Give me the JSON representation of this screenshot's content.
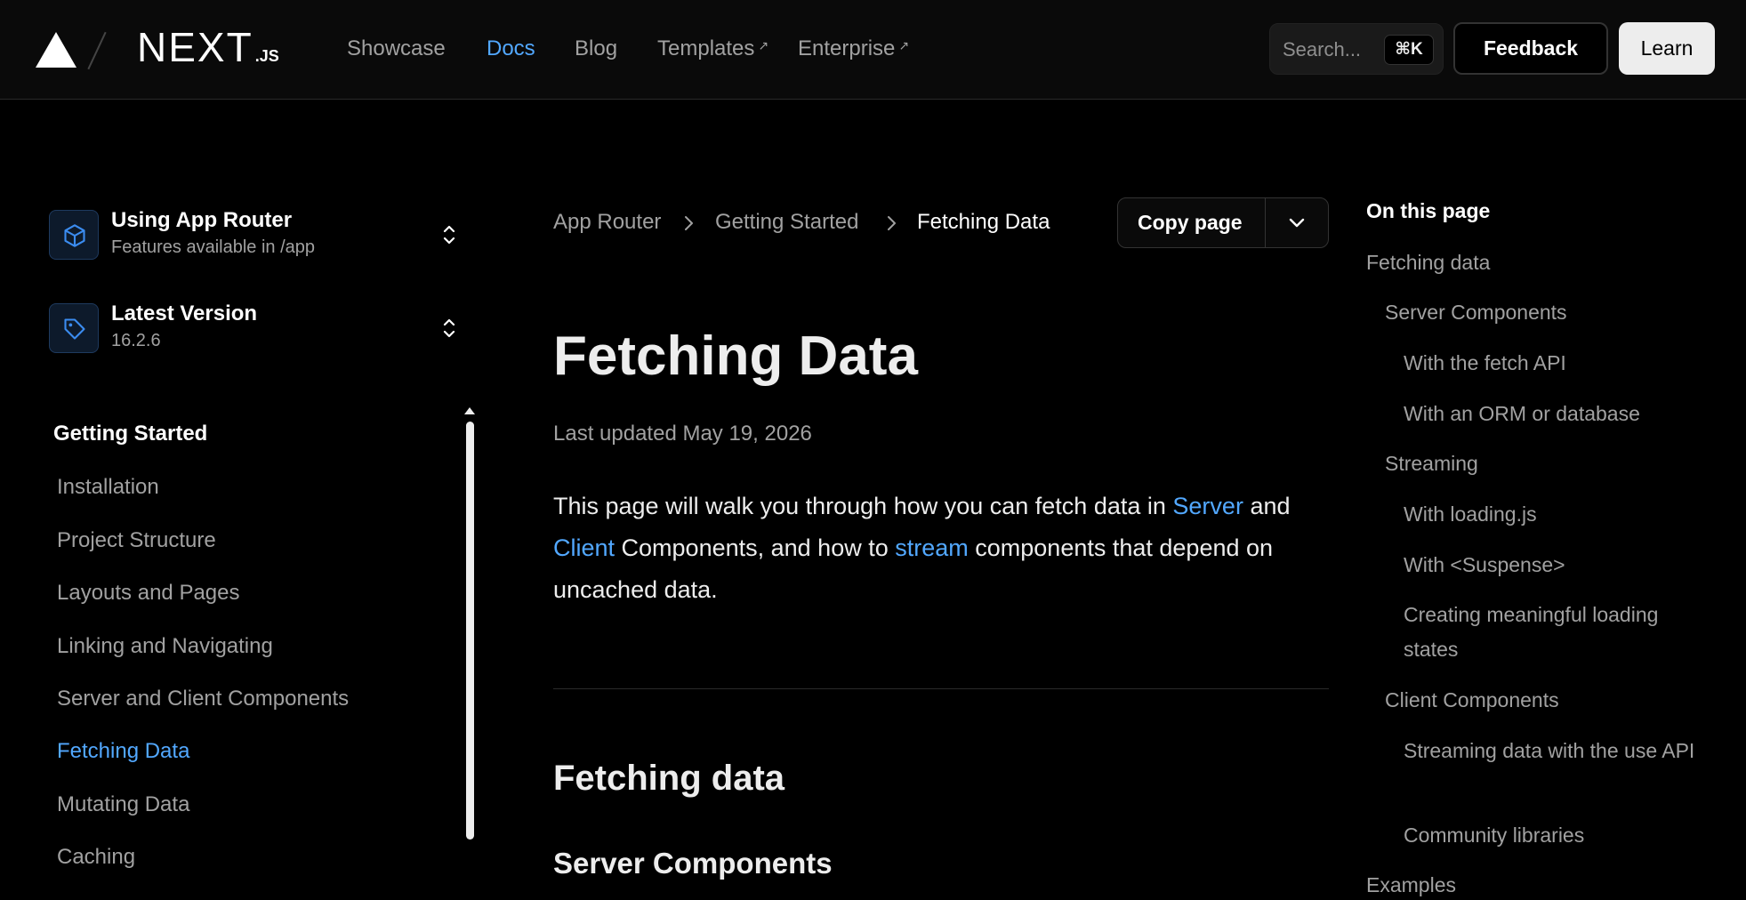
{
  "header": {
    "logo_text": "NEXT",
    "logo_suffix": ".JS",
    "nav": [
      {
        "label": "Showcase"
      },
      {
        "label": "Docs"
      },
      {
        "label": "Blog"
      },
      {
        "label": "Templates"
      },
      {
        "label": "Enterprise"
      }
    ],
    "external_marker": "↗",
    "search_placeholder": "Search...",
    "search_shortcut": "⌘K",
    "feedback_label": "Feedback",
    "learn_label": "Learn"
  },
  "sidebar": {
    "router_selector": {
      "title": "Using App Router",
      "subtitle": "Features available in /app"
    },
    "version_selector": {
      "title": "Latest Version",
      "subtitle": "16.2.6"
    },
    "section_heading": "Getting Started",
    "items": [
      {
        "label": "Installation"
      },
      {
        "label": "Project Structure"
      },
      {
        "label": "Layouts and Pages"
      },
      {
        "label": "Linking and Navigating"
      },
      {
        "label": "Server and Client Components"
      },
      {
        "label": "Fetching Data"
      },
      {
        "label": "Mutating Data"
      },
      {
        "label": "Caching"
      }
    ]
  },
  "main": {
    "breadcrumb": [
      "App Router",
      "Getting Started",
      "Fetching Data"
    ],
    "copy_page_label": "Copy page",
    "title": "Fetching Data",
    "last_updated": "Last updated May 19, 2026",
    "intro": {
      "t1": "This page will walk you through how you can fetch data in ",
      "link1": "Server",
      "t2": " and ",
      "link2": "Client",
      "t3": " Components, and how to ",
      "link3": "stream",
      "t4": " components that depend on uncached data."
    },
    "h2": "Fetching data",
    "h3": "Server Components"
  },
  "toc": {
    "title": "On this page",
    "items": [
      {
        "label": "Fetching data"
      },
      {
        "label": "Server Components"
      },
      {
        "label": "With the fetch API"
      },
      {
        "label": "With an ORM or database"
      },
      {
        "label": "Streaming"
      },
      {
        "label": "With loading.js"
      },
      {
        "label": "With <Suspense>"
      },
      {
        "label": "Creating meaningful loading states"
      },
      {
        "label": "Client Components"
      },
      {
        "label": "Streaming data with the use API"
      },
      {
        "label": "Community libraries"
      },
      {
        "label": "Examples"
      }
    ]
  },
  "colors": {
    "accent": "#52a8ff",
    "background": "#000000",
    "text": "#ededed",
    "muted": "#a1a1a1"
  }
}
